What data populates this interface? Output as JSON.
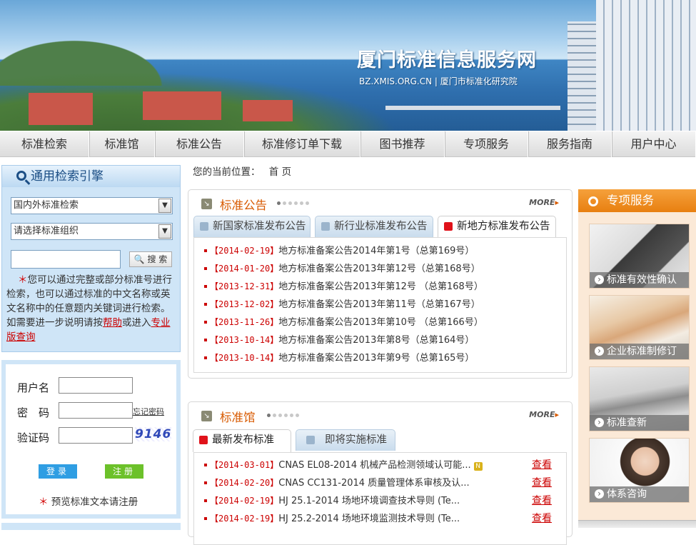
{
  "banner": {
    "title": "厦门标准信息服务网",
    "subtitle": "BZ.XMIS.ORG.CN  |  厦门市标准化研究院"
  },
  "nav": [
    "标准检索",
    "标准馆",
    "标准公告",
    "标准修订单下载",
    "图书推荐",
    "专项服务",
    "服务指南",
    "用户中心"
  ],
  "search": {
    "heading": "通用检索引擎",
    "select1": "国内外标准检索",
    "select2": "请选择标准组织",
    "keyword_value": "",
    "button": "搜 索",
    "help_star": "＊",
    "help_text": "您可以通过完整或部分标准号进行检索，也可以通过标准的中文名称或英文名称中的任意题内关键词进行检索。 如需要进一步说明请按",
    "help_link": "帮助",
    "help_mid": "或进入",
    "pro_link": "专业版查询"
  },
  "login": {
    "username_label": "用户名",
    "password_label": "密　码",
    "captcha_label": "验证码",
    "forgot": "忘记密码",
    "captcha_value": "9146",
    "login_button": "登录",
    "register_button": "注册",
    "note_star": "＊",
    "note": "预览标准文本请注册"
  },
  "breadcrumb": {
    "label": "您的当前位置：",
    "home": "首 页"
  },
  "announcements": {
    "title": "标准公告",
    "more": "MORE",
    "tabs": [
      "新国家标准发布公告",
      "新行业标准发布公告",
      "新地方标准发布公告"
    ],
    "active_tab": 2,
    "items": [
      {
        "date": "【2014-02-19】",
        "text": "地方标准备案公告2014年第1号（总第169号）"
      },
      {
        "date": "【2014-01-20】",
        "text": "地方标准备案公告2013年第12号（总第168号）"
      },
      {
        "date": "【2013-12-31】",
        "text": "地方标准备案公告2013年第12号 （总第168号）"
      },
      {
        "date": "【2013-12-02】",
        "text": "地方标准备案公告2013年第11号（总第167号）"
      },
      {
        "date": "【2013-11-26】",
        "text": "地方标准备案公告2013年第10号 （总第166号）"
      },
      {
        "date": "【2013-10-14】",
        "text": "地方标准备案公告2013年第8号（总第164号）"
      },
      {
        "date": "【2013-10-14】",
        "text": "地方标准备案公告2013年第9号（总第165号）"
      }
    ]
  },
  "library": {
    "title": "标准馆",
    "more": "MORE",
    "tabs": [
      "最新发布标准",
      "即将实施标准"
    ],
    "active_tab": 0,
    "view_label": "查看",
    "new_badge": "N",
    "items": [
      {
        "date": "【2014-03-01】",
        "text": "CNAS EL08-2014 机械产品检测领域认可能...",
        "new": true
      },
      {
        "date": "【2014-02-20】",
        "text": "CNAS CC131-2014 质量管理体系审核及认...",
        "new": false
      },
      {
        "date": "【2014-02-19】",
        "text": "HJ 25.1-2014 场地环境调查技术导则 (Te...",
        "new": false
      },
      {
        "date": "【2014-02-19】",
        "text": "HJ 25.2-2014 场地环境监测技术导则 (Te...",
        "new": false
      }
    ]
  },
  "special": {
    "title": "专项服务",
    "items": [
      "标准有效性确认",
      "企业标准制修订",
      "标准查新",
      "体系咨询"
    ]
  },
  "colors": {
    "accent_orange": "#e87f10",
    "nav_bg": "#dcdcdc",
    "left_panel": "#cfe5f7",
    "link_red": "#cc0000"
  }
}
